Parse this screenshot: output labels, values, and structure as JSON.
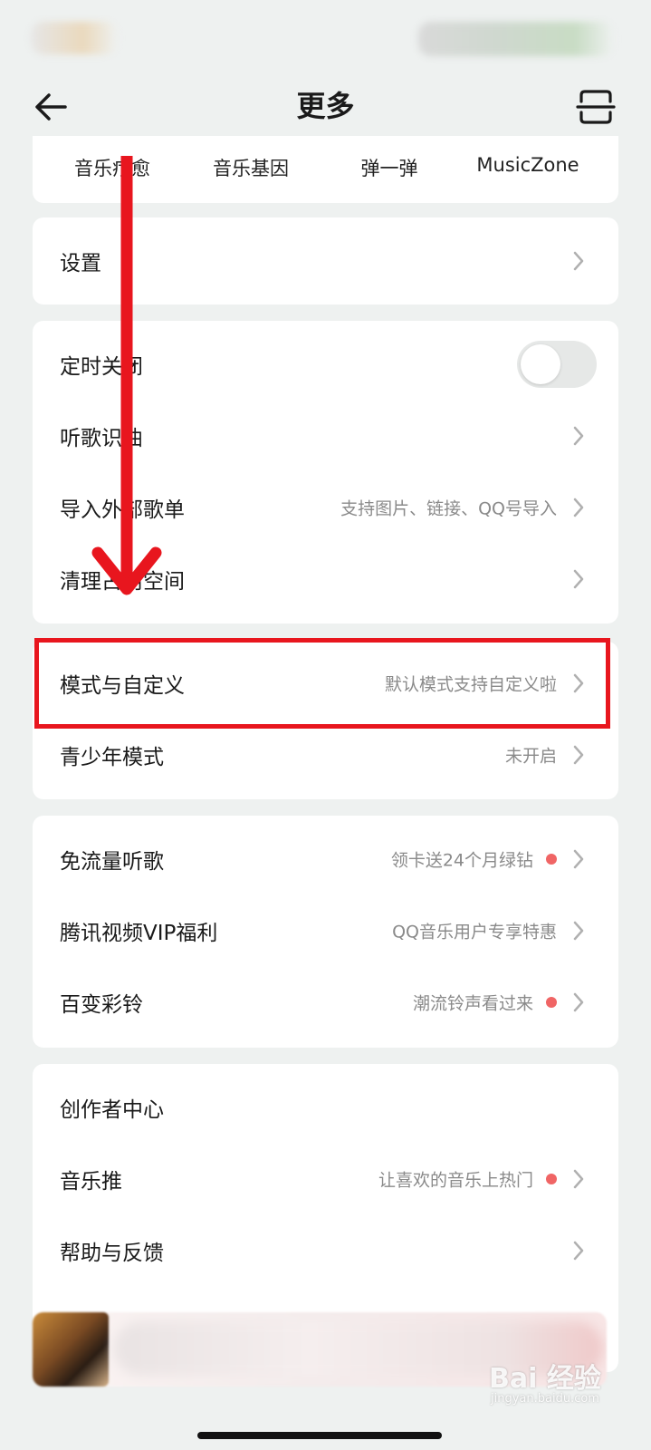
{
  "header": {
    "title": "更多"
  },
  "top_shortcuts": [
    {
      "label": "音乐疗愈"
    },
    {
      "label": "音乐基因"
    },
    {
      "label": "弹一弹"
    },
    {
      "label": "MusicZone"
    }
  ],
  "settings_card": {
    "settings": {
      "label": "设置"
    }
  },
  "tools_card": {
    "timer_off": {
      "label": "定时关闭",
      "toggle_on": false
    },
    "recognize_song": {
      "label": "听歌识曲"
    },
    "import_playlist": {
      "label": "导入外部歌单",
      "sub": "支持图片、链接、QQ号导入"
    },
    "clean_space": {
      "label": "清理占用空间"
    }
  },
  "mode_card": {
    "mode_custom": {
      "label": "模式与自定义",
      "sub": "默认模式支持自定义啦"
    },
    "teen_mode": {
      "label": "青少年模式",
      "sub": "未开启"
    }
  },
  "benefits_card": {
    "free_data": {
      "label": "免流量听歌",
      "sub": "领卡送24个月绿钻",
      "red_dot": true
    },
    "tencent_video": {
      "label": "腾讯视频VIP福利",
      "sub": "QQ音乐用户专享特惠"
    },
    "ringtone": {
      "label": "百变彩铃",
      "sub": "潮流铃声看过来",
      "red_dot": true
    }
  },
  "creator_card": {
    "creator_center": {
      "label": "创作者中心"
    },
    "music_promo": {
      "label": "音乐推",
      "sub": "让喜欢的音乐上热门",
      "red_dot": true
    },
    "help_feedback": {
      "label": "帮助与反馈"
    }
  },
  "watermark": {
    "logo": "Bai 经验",
    "url": "jingyan.baidu.com"
  },
  "colors": {
    "annotation": "#e8161e",
    "red_dot": "#f06565",
    "background": "#eef1f0"
  },
  "icons": [
    "back-arrow-icon",
    "scan-icon",
    "chevron-right-icon",
    "red-dot",
    "toggle-switch",
    "annotation-arrow-icon"
  ]
}
